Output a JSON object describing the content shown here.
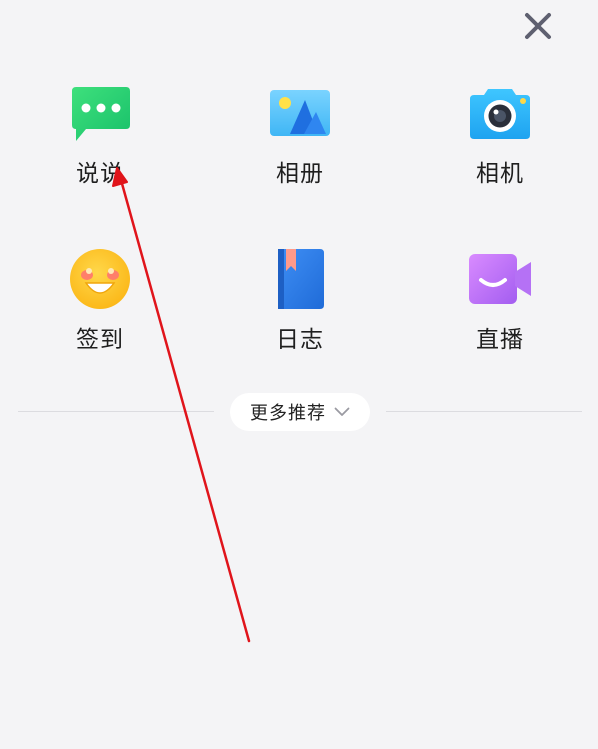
{
  "close": {
    "icon": "close-icon"
  },
  "grid": {
    "items": [
      {
        "label": "说说",
        "icon": "chat-bubble-icon"
      },
      {
        "label": "相册",
        "icon": "photo-album-icon"
      },
      {
        "label": "相机",
        "icon": "camera-icon"
      },
      {
        "label": "签到",
        "icon": "smiley-face-icon"
      },
      {
        "label": "日志",
        "icon": "diary-book-icon"
      },
      {
        "label": "直播",
        "icon": "live-video-icon"
      }
    ]
  },
  "more": {
    "label": "更多推荐",
    "icon": "chevron-down-icon"
  },
  "annotation": {
    "color": "#e0141b"
  }
}
